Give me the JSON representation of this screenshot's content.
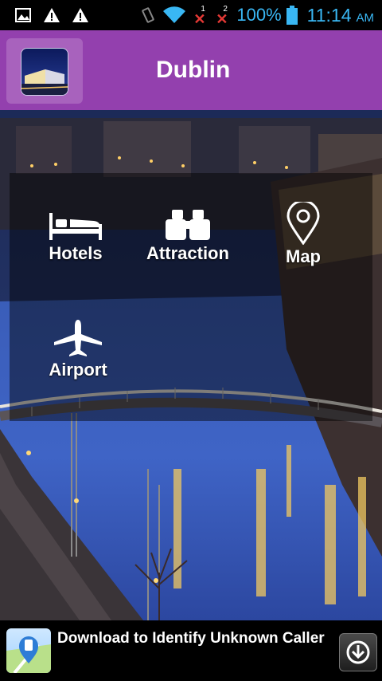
{
  "status_bar": {
    "sim1_label": "1",
    "sim2_label": "2",
    "no_signal_mark": "✕",
    "battery": "100%",
    "time": "11:14",
    "ampm": "AM",
    "icons": [
      "image-icon",
      "warning-icon",
      "warning-icon",
      "vibrate-icon",
      "wifi-icon",
      "sim1-no-signal-icon",
      "sim2-no-signal-icon",
      "battery-icon"
    ]
  },
  "header": {
    "title": "Dublin",
    "color": "#9340ae"
  },
  "menu": {
    "items": [
      {
        "label": "Hotels",
        "icon": "bed-icon"
      },
      {
        "label": "Attraction",
        "icon": "binoculars-icon"
      },
      {
        "label": "Map",
        "icon": "map-pin-icon"
      },
      {
        "label": "Airport",
        "icon": "airplane-icon"
      }
    ]
  },
  "ad": {
    "text": "Download to Identify Unknown Caller",
    "icon": "caller-id-app-icon",
    "button_icon": "download-icon"
  }
}
